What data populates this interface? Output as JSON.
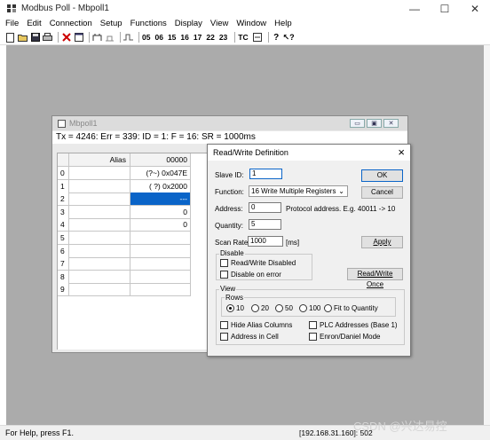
{
  "app": {
    "title": "Modbus Poll - Mbpoll1",
    "window_controls": {
      "minimize": "—",
      "maximize": "☐",
      "close": "✕"
    }
  },
  "menu": [
    "File",
    "Edit",
    "Connection",
    "Setup",
    "Functions",
    "Display",
    "View",
    "Window",
    "Help"
  ],
  "toolbar": {
    "function_codes": [
      "05",
      "06",
      "15",
      "16",
      "17",
      "22",
      "23"
    ],
    "tc_label": "TC"
  },
  "child": {
    "title": "Mbpoll1",
    "status_line": "Tx = 4246: Err = 339: ID = 1: F = 16: SR = 1000ms",
    "controls": [
      "▭",
      "▣",
      "✕"
    ],
    "grid": {
      "alias_header": "Alias",
      "value_header": "00000",
      "rows": [
        {
          "index": "0",
          "alias": "",
          "value": "(?~) 0x047E"
        },
        {
          "index": "1",
          "alias": "",
          "value": "( ?) 0x2000"
        },
        {
          "index": "2",
          "alias": "",
          "value": "---",
          "selected": true
        },
        {
          "index": "3",
          "alias": "",
          "value": "0"
        },
        {
          "index": "4",
          "alias": "",
          "value": "0"
        },
        {
          "index": "5",
          "alias": "",
          "value": ""
        },
        {
          "index": "6",
          "alias": "",
          "value": ""
        },
        {
          "index": "7",
          "alias": "",
          "value": ""
        },
        {
          "index": "8",
          "alias": "",
          "value": ""
        },
        {
          "index": "9",
          "alias": "",
          "value": ""
        }
      ]
    }
  },
  "dialog": {
    "title": "Read/Write Definition",
    "slave_id_label": "Slave ID:",
    "slave_id_value": "1",
    "function_label": "Function:",
    "function_value": "16 Write Multiple Registers",
    "address_label": "Address:",
    "address_value": "0",
    "address_hint": "Protocol address. E.g. 40011 -> 10",
    "quantity_label": "Quantity:",
    "quantity_value": "5",
    "scan_rate_label": "Scan Rate:",
    "scan_rate_value": "1000",
    "scan_rate_unit": "[ms]",
    "ok_label": "OK",
    "cancel_label": "Cancel",
    "apply_label": "Apply",
    "disable_group": "Disable",
    "disable_rw_label": "Read/Write Disabled",
    "disable_rw_checked": false,
    "disable_err_label": "Disable on error",
    "disable_err_checked": false,
    "rw_once_label": "Read/Write Once",
    "view_group": "View",
    "rows_group": "Rows",
    "rows_options": [
      "10",
      "20",
      "50",
      "100",
      "Fit to Quantity"
    ],
    "rows_selected": "10",
    "hide_alias_label": "Hide Alias Columns",
    "address_in_cell_label": "Address in Cell",
    "plc_addresses_label": "PLC Addresses (Base 1)",
    "enron_label": "Enron/Daniel Mode"
  },
  "status": {
    "help_text": "For Help, press F1.",
    "connection": "[192.168.31.160]: 502"
  },
  "watermark": "CSDN @兴达易控",
  "colors": {
    "mdi_background": "#ababab",
    "selection": "#0a64c8",
    "dialog_bg": "#f0f0f0"
  }
}
